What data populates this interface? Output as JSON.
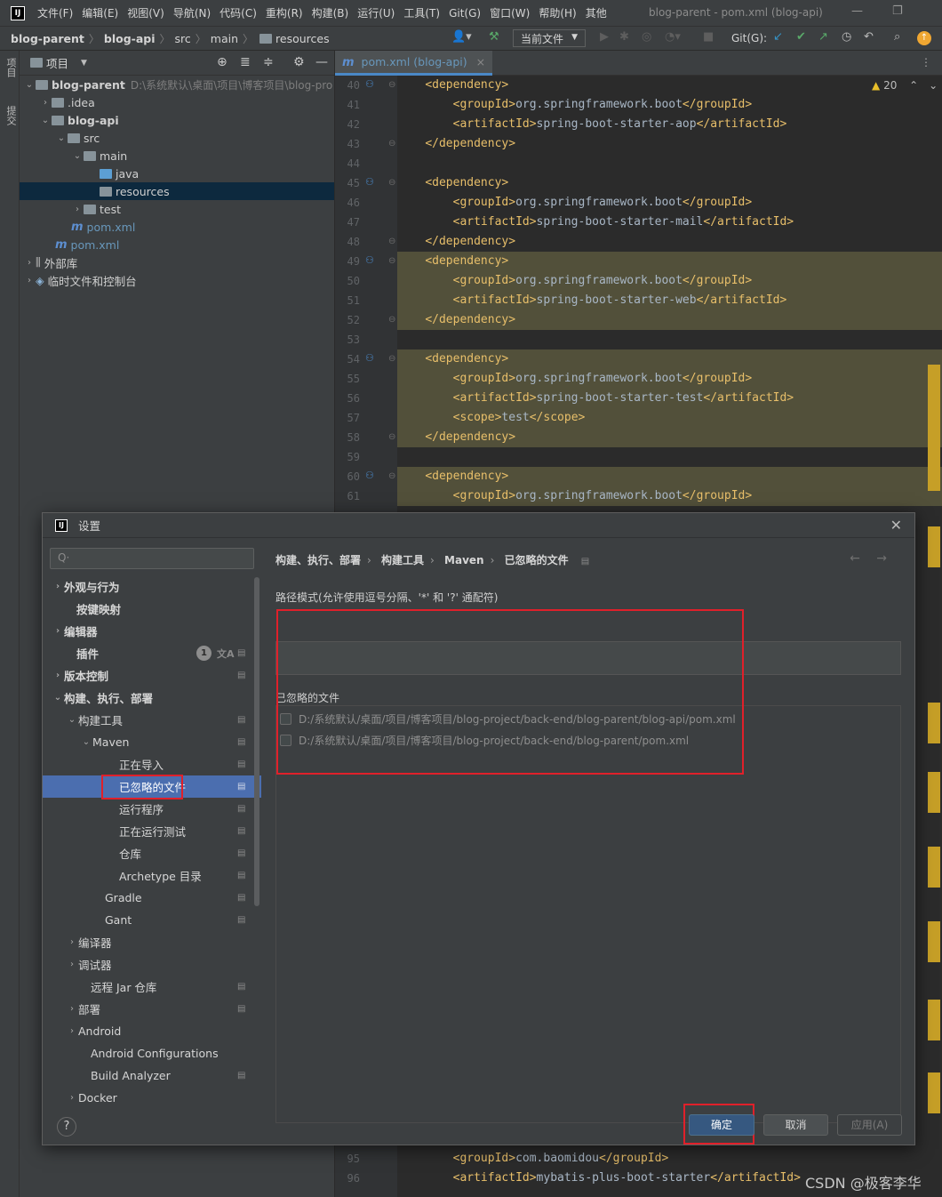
{
  "menubar": {
    "items": [
      "文件(F)",
      "编辑(E)",
      "视图(V)",
      "导航(N)",
      "代码(C)",
      "重构(R)",
      "构建(B)",
      "运行(U)",
      "工具(T)",
      "Git(G)",
      "窗口(W)",
      "帮助(H)",
      "其他"
    ],
    "window_title": "blog-parent - pom.xml (blog-api)"
  },
  "navbar": {
    "breadcrumb": [
      "blog-parent",
      "blog-api",
      "src",
      "main",
      "resources"
    ],
    "run_config": "当前文件",
    "git_label": "Git(G):"
  },
  "side_tabs": {
    "project": "项目",
    "commit": "提交"
  },
  "project_panel": {
    "title": "项目",
    "tree": [
      {
        "label": "blog-parent",
        "hint": "D:\\系统默认\\桌面\\项目\\博客项目\\blog-pro"
      },
      {
        "label": ".idea"
      },
      {
        "label": "blog-api"
      },
      {
        "label": "src"
      },
      {
        "label": "main"
      },
      {
        "label": "java"
      },
      {
        "label": "resources"
      },
      {
        "label": "test"
      },
      {
        "label": "pom.xml"
      },
      {
        "label": "pom.xml"
      },
      {
        "label": "外部库"
      },
      {
        "label": "临时文件和控制台"
      }
    ]
  },
  "editor": {
    "tab": "pom.xml (blog-api)",
    "warnings": "20",
    "lines": [
      {
        "n": "40",
        "text": "    <dependency>"
      },
      {
        "n": "41",
        "text": "        <groupId>org.springframework.boot</groupId>"
      },
      {
        "n": "42",
        "text": "        <artifactId>spring-boot-starter-aop</artifactId>"
      },
      {
        "n": "43",
        "text": "    </dependency>"
      },
      {
        "n": "44",
        "text": ""
      },
      {
        "n": "45",
        "text": "    <dependency>"
      },
      {
        "n": "46",
        "text": "        <groupId>org.springframework.boot</groupId>"
      },
      {
        "n": "47",
        "text": "        <artifactId>spring-boot-starter-mail</artifactId>"
      },
      {
        "n": "48",
        "text": "    </dependency>"
      },
      {
        "n": "49",
        "text": "    <dependency>"
      },
      {
        "n": "50",
        "text": "        <groupId>org.springframework.boot</groupId>"
      },
      {
        "n": "51",
        "text": "        <artifactId>spring-boot-starter-web</artifactId>"
      },
      {
        "n": "52",
        "text": "    </dependency>"
      },
      {
        "n": "53",
        "text": ""
      },
      {
        "n": "54",
        "text": "    <dependency>"
      },
      {
        "n": "55",
        "text": "        <groupId>org.springframework.boot</groupId>"
      },
      {
        "n": "56",
        "text": "        <artifactId>spring-boot-starter-test</artifactId>"
      },
      {
        "n": "57",
        "text": "        <scope>test</scope>"
      },
      {
        "n": "58",
        "text": "    </dependency>"
      },
      {
        "n": "59",
        "text": ""
      },
      {
        "n": "60",
        "text": "    <dependency>"
      },
      {
        "n": "61",
        "text": "        <groupId>org.springframework.boot</groupId>"
      }
    ],
    "bottom_lines": [
      {
        "n": "95",
        "text": "        <groupId>com.baomidou</groupId>"
      },
      {
        "n": "96",
        "text": "        <artifactId>mybatis-plus-boot-starter</artifactId>"
      }
    ]
  },
  "dialog": {
    "title": "设置",
    "search_placeholder": "Q·",
    "tree": [
      "外观与行为",
      "按键映射",
      "编辑器",
      "插件",
      "版本控制",
      "构建、执行、部署",
      "构建工具",
      "Maven",
      "正在导入",
      "已忽略的文件",
      "运行程序",
      "正在运行测试",
      "仓库",
      "Archetype 目录",
      "Gradle",
      "Gant",
      "编译器",
      "调试器",
      "远程 Jar 仓库",
      "部署",
      "Android",
      "Android Configurations",
      "Build Analyzer",
      "Docker"
    ],
    "plugins_badge": "1",
    "breadcrumb": [
      "构建、执行、部署",
      "构建工具",
      "Maven",
      "已忽略的文件"
    ],
    "pattern_label": "路径模式(允许使用逗号分隔、'*' 和 '?' 通配符)",
    "ignored_label": "已忽略的文件",
    "ignored_files": [
      "D:/系统默认/桌面/项目/博客项目/blog-project/back-end/blog-parent/blog-api/pom.xml",
      "D:/系统默认/桌面/项目/博客项目/blog-project/back-end/blog-parent/pom.xml"
    ],
    "buttons": {
      "ok": "确定",
      "cancel": "取消",
      "apply": "应用(A)",
      "help": "?"
    }
  },
  "watermark": "CSDN @极客李华",
  "colors": {
    "accent": "#4b6eaf",
    "highlight": "#52503a",
    "annotation": "#e0202a",
    "xml_tag": "#e8bf6a"
  }
}
